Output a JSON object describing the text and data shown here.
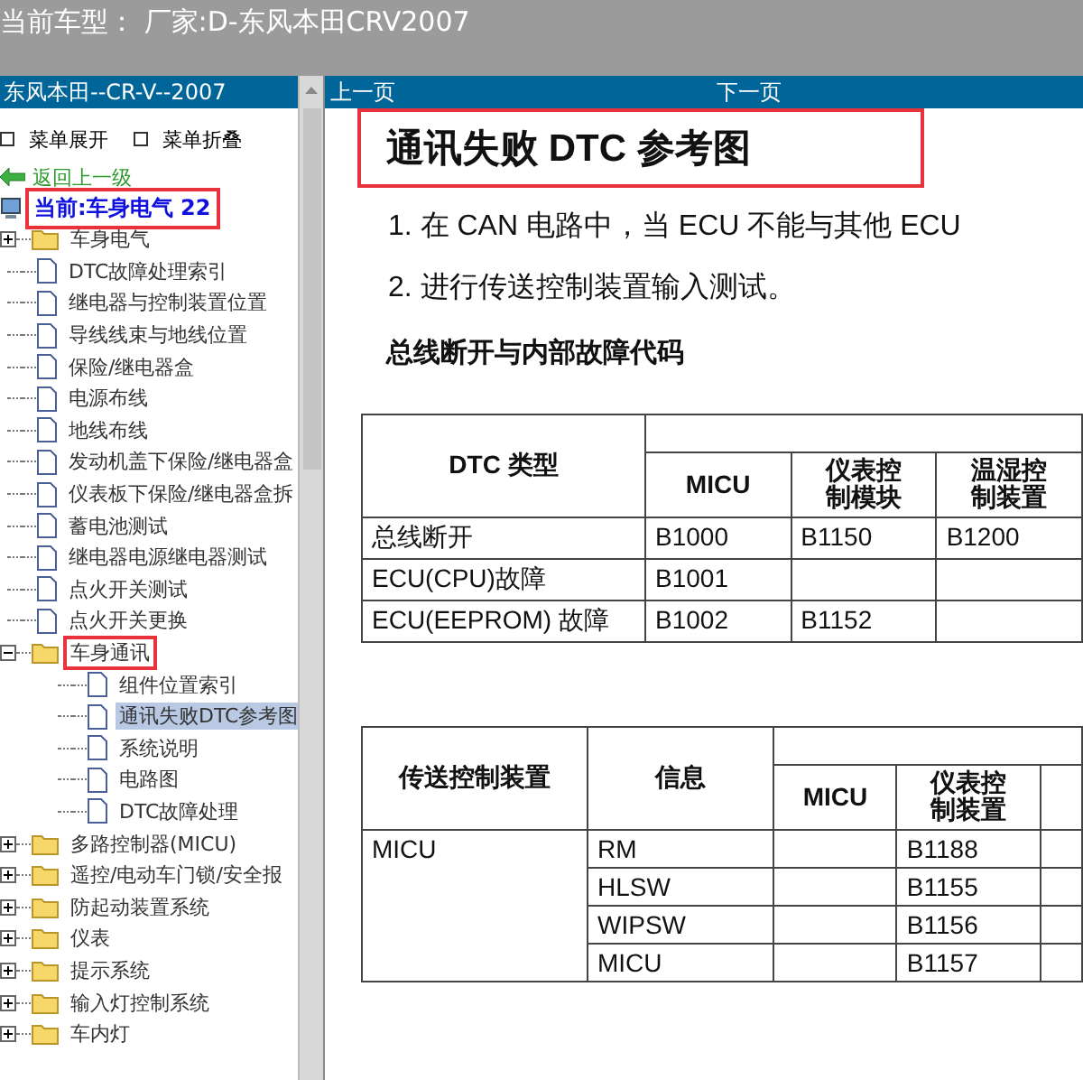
{
  "window": {
    "title": "当前车型： 厂家:D-东风本田CRV2007"
  },
  "sidebar": {
    "title": "东风本田--CR-V--2007",
    "toolbar": [
      "菜单展开",
      "菜单折叠"
    ],
    "back_link": "返回上一级",
    "current": {
      "label": "当前:车身电气 22",
      "highlighted": true
    },
    "tree": [
      {
        "kind": "folder",
        "label": "车身电气",
        "expanded": false,
        "selected": false,
        "highlighted": false
      },
      {
        "kind": "doc",
        "label": "DTC故障处理索引",
        "selected": false
      },
      {
        "kind": "doc",
        "label": "继电器与控制装置位置",
        "selected": false
      },
      {
        "kind": "doc",
        "label": "导线线束与地线位置",
        "selected": false
      },
      {
        "kind": "doc",
        "label": "保险/继电器盒",
        "selected": false
      },
      {
        "kind": "doc",
        "label": "电源布线",
        "selected": false
      },
      {
        "kind": "doc",
        "label": "地线布线",
        "selected": false
      },
      {
        "kind": "doc",
        "label": "发动机盖下保险/继电器盒",
        "selected": false
      },
      {
        "kind": "doc",
        "label": "仪表板下保险/继电器盒拆",
        "selected": false
      },
      {
        "kind": "doc",
        "label": "蓄电池测试",
        "selected": false
      },
      {
        "kind": "doc",
        "label": "继电器电源继电器测试",
        "selected": false
      },
      {
        "kind": "doc",
        "label": "点火开关测试",
        "selected": false
      },
      {
        "kind": "doc",
        "label": "点火开关更换",
        "selected": false
      },
      {
        "kind": "folder",
        "label": "车身通讯",
        "expanded": true,
        "selected": false,
        "highlighted": true,
        "children": [
          {
            "kind": "doc",
            "label": "组件位置索引",
            "selected": false
          },
          {
            "kind": "doc",
            "label": "通讯失败DTC参考图",
            "selected": true
          },
          {
            "kind": "doc",
            "label": "系统说明",
            "selected": false
          },
          {
            "kind": "doc",
            "label": "电路图",
            "selected": false
          },
          {
            "kind": "doc",
            "label": "DTC故障处理",
            "selected": false
          }
        ]
      },
      {
        "kind": "folder",
        "label": "多路控制器(MICU)",
        "expanded": false,
        "selected": false,
        "highlighted": false
      },
      {
        "kind": "folder",
        "label": "遥控/电动车门锁/安全报",
        "expanded": false,
        "selected": false,
        "highlighted": false
      },
      {
        "kind": "folder",
        "label": "防起动装置系统",
        "expanded": false,
        "selected": false,
        "highlighted": false
      },
      {
        "kind": "folder",
        "label": "仪表",
        "expanded": false,
        "selected": false,
        "highlighted": false
      },
      {
        "kind": "folder",
        "label": "提示系统",
        "expanded": false,
        "selected": false,
        "highlighted": false
      },
      {
        "kind": "folder",
        "label": "输入灯控制系统",
        "expanded": false,
        "selected": false,
        "highlighted": false
      },
      {
        "kind": "folder",
        "label": "车内灯",
        "expanded": false,
        "selected": false,
        "highlighted": false
      }
    ]
  },
  "pager": {
    "prev": "上一页",
    "next": "下一页"
  },
  "document": {
    "title": "通讯失败 DTC 参考图",
    "title_highlighted": true,
    "steps": [
      "1. 在 CAN 电路中，当 ECU 不能与其他 ECU",
      "2. 进行传送控制装置输入测试。"
    ],
    "heading": "总线断开与内部故障代码",
    "table_1": {
      "columns": [
        "DTC 类型",
        "MICU",
        "仪表控制模块",
        "温湿控制装置"
      ],
      "rows": [
        [
          "总线断开",
          "B1000",
          "B1150",
          "B1200"
        ],
        [
          "ECU(CPU)故障",
          "B1001",
          null,
          null
        ],
        [
          "ECU(EEPROM) 故障",
          "B1002",
          "B1152",
          null
        ]
      ]
    },
    "table_2": {
      "columns": [
        "传送控制装置",
        "信息",
        "MICU",
        "仪表控制装置"
      ],
      "groups": [
        {
          "device": "MICU",
          "rows": [
            [
              "RM",
              null,
              "B1188"
            ],
            [
              "HLSW",
              null,
              "B1155"
            ],
            [
              "WIPSW",
              null,
              "B1156"
            ],
            [
              "MICU",
              null,
              "B1157"
            ]
          ]
        }
      ]
    }
  }
}
